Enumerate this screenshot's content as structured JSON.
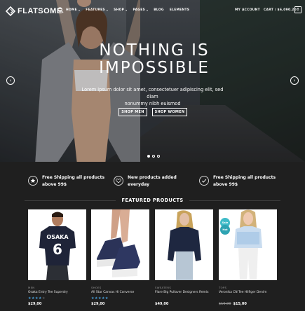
{
  "header": {
    "logo_text": "FLATSOME",
    "nav": [
      {
        "label": "HOME",
        "has_caret": true
      },
      {
        "label": "FEATURES",
        "has_caret": true
      },
      {
        "label": "SHOP",
        "has_caret": true
      },
      {
        "label": "PAGES",
        "has_caret": true
      },
      {
        "label": "BLOG",
        "has_caret": false
      },
      {
        "label": "ELEMENTS",
        "has_caret": false
      }
    ],
    "account_label": "MY ACCOUNT",
    "cart_label": "CART / $6,090.20",
    "cart_count": "8"
  },
  "hero": {
    "headline_line1": "NOTHING IS",
    "headline_line2": "IMPOSSIBLE",
    "subtext_line1": "Lorem ipsum dolor sit amet, consectetuer adipiscing elit, sed diam",
    "subtext_line2": "nonummy nibh euismod",
    "cta_men": "SHOP MEN",
    "cta_women": "SHOP WOMEN",
    "arrow_left": "‹",
    "arrow_right": "›",
    "slides": 3,
    "active_slide": 1
  },
  "features": [
    {
      "icon": "star-icon",
      "line1": "Free Shipping all products",
      "line2": "above 99$"
    },
    {
      "icon": "heart-icon",
      "line1": "New products added",
      "line2": "everyday"
    },
    {
      "icon": "checkmark-icon",
      "line1": "Free Shipping all products",
      "line2": "above 99$"
    }
  ],
  "featured": {
    "title": "FEATURED PRODUCTS",
    "products": [
      {
        "category": "MEN",
        "name": "Osaka Entry Tee Superdry",
        "rating": 4,
        "price": "$29,00",
        "old_price": ""
      },
      {
        "category": "SHOES",
        "name": "All Star Canvas Hi Converse",
        "rating": 5,
        "price": "$29,00",
        "old_price": ""
      },
      {
        "category": "SWEATERS",
        "name": "Flare Big Pullover Designers Remix",
        "rating": 0,
        "price": "$49,00",
        "old_price": ""
      },
      {
        "category": "TOPS",
        "name": "Veronika CN Tee Hilfiger Denim",
        "rating": 0,
        "price": "$15,00",
        "old_price": "$19,00"
      }
    ],
    "badges": [
      "Sale",
      "Hot"
    ]
  },
  "colors": {
    "dark_bg": "#1f1f1f",
    "rating_blue": "#4aa3e0",
    "badge_teal": "#3fbbc8"
  }
}
